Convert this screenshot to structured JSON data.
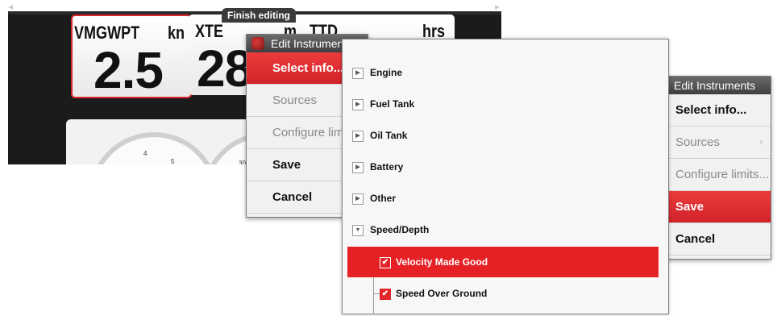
{
  "finish_editing": "Finish editing",
  "instruments": {
    "tile1_label": "VMGWPT",
    "tile1_unit": "kn",
    "tile1_value": "2.5",
    "tile2_label": "XTE",
    "tile2_unit": "m",
    "tile2_value": "28",
    "tile3_label": "TTD",
    "tile3_unit": "hrs",
    "gauge1_tick_a": "4",
    "gauge1_tick_b": "5",
    "gauge2_tick": "30"
  },
  "menu_left": {
    "title": "Edit Instruments",
    "items": [
      {
        "label": "Select info...",
        "state": "selected"
      },
      {
        "label": "Sources",
        "state": "disabled"
      },
      {
        "label": "Configure limits...",
        "state": "disabled"
      },
      {
        "label": "Save",
        "state": "normal"
      },
      {
        "label": "Cancel",
        "state": "normal"
      }
    ]
  },
  "menu_right": {
    "title": "Edit Instruments",
    "items": [
      {
        "label": "Select info...",
        "state": "normal"
      },
      {
        "label": "Sources",
        "state": "disabled"
      },
      {
        "label": "Configure limits...",
        "state": "disabled"
      },
      {
        "label": "Save",
        "state": "selected"
      },
      {
        "label": "Cancel",
        "state": "normal"
      }
    ]
  },
  "tree": {
    "categories": [
      {
        "label": "Engine",
        "expanded": false
      },
      {
        "label": "Fuel Tank",
        "expanded": false
      },
      {
        "label": "Oil Tank",
        "expanded": false
      },
      {
        "label": "Battery",
        "expanded": false
      },
      {
        "label": "Other",
        "expanded": false
      },
      {
        "label": "Speed/Depth",
        "expanded": true
      }
    ],
    "children": [
      {
        "label": "Velocity Made Good",
        "checked": true,
        "selected": true
      },
      {
        "label": "Speed Over Ground",
        "checked": true,
        "selected": false
      }
    ]
  },
  "colors": {
    "accent_red": "#e52125",
    "title_bar": "#4a4a4a",
    "panel_bg": "#1b1b1b"
  }
}
